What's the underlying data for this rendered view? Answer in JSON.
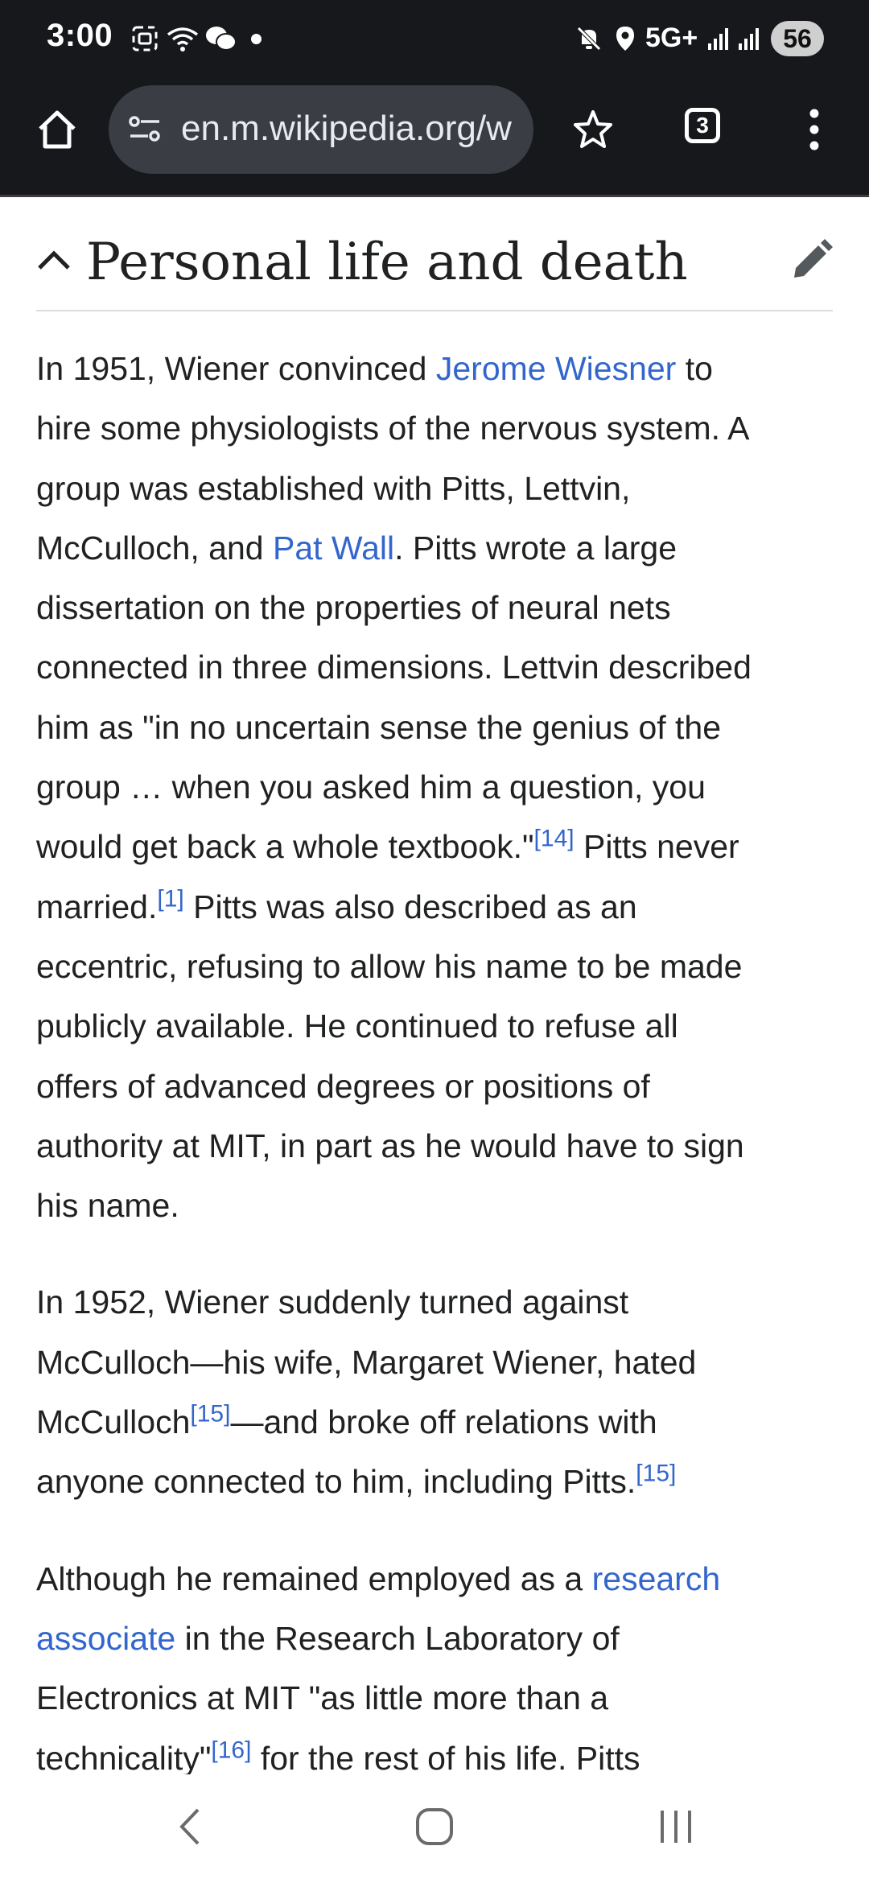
{
  "status_bar": {
    "time": "3:00",
    "network": "5G+",
    "battery": "56"
  },
  "toolbar": {
    "url": "en.m.wikipedia.org/w",
    "tab_count": "3"
  },
  "section": {
    "title": "Personal life and death"
  },
  "paragraphs": {
    "p1": {
      "l1_a": "In 1951, Wiener convinced ",
      "l1_link": "Jerome Wiesner",
      "l1_b": " to",
      "l2": "hire some physiologists of the nervous system. A",
      "l3": "group was established with Pitts, Lettvin,",
      "l4_a": "McCulloch, and ",
      "l4_link": "Pat Wall",
      "l4_b": ". Pitts wrote a large",
      "l5": "dissertation on the properties of neural nets",
      "l6": "connected in three dimensions. Lettvin described",
      "l7": "him as \"in no uncertain sense the genius of the",
      "l8": "group … when you asked him a question, you",
      "l9_a": "would get back a whole textbook.\"",
      "l9_ref": "[14]",
      "l9_b": " Pitts never",
      "l10_a": "married.",
      "l10_ref": "[1]",
      "l10_b": " Pitts was also described as an",
      "l11": "eccentric, refusing to allow his name to be made",
      "l12": "publicly available. He continued to refuse all",
      "l13": "offers of advanced degrees or positions of",
      "l14": "authority at MIT, in part as he would have to sign",
      "l15": "his name."
    },
    "p2": {
      "l1": "In 1952, Wiener suddenly turned against",
      "l2": "McCulloch—his wife, Margaret Wiener, hated",
      "l3_a": "McCulloch",
      "l3_ref": "[15]",
      "l3_b": "—and broke off relations with",
      "l4_a": "anyone connected to him, including Pitts.",
      "l4_ref": "[15]"
    },
    "p3": {
      "l1_a": "Although he remained employed as a ",
      "l1_link": "research",
      "l2_link": "associate",
      "l2_b": " in the Research Laboratory of",
      "l3": "Electronics at MIT \"as little more than a",
      "l4_a": "technicality\"",
      "l4_ref": "[16]",
      "l4_b": " for the rest of his life. Pitts"
    }
  }
}
